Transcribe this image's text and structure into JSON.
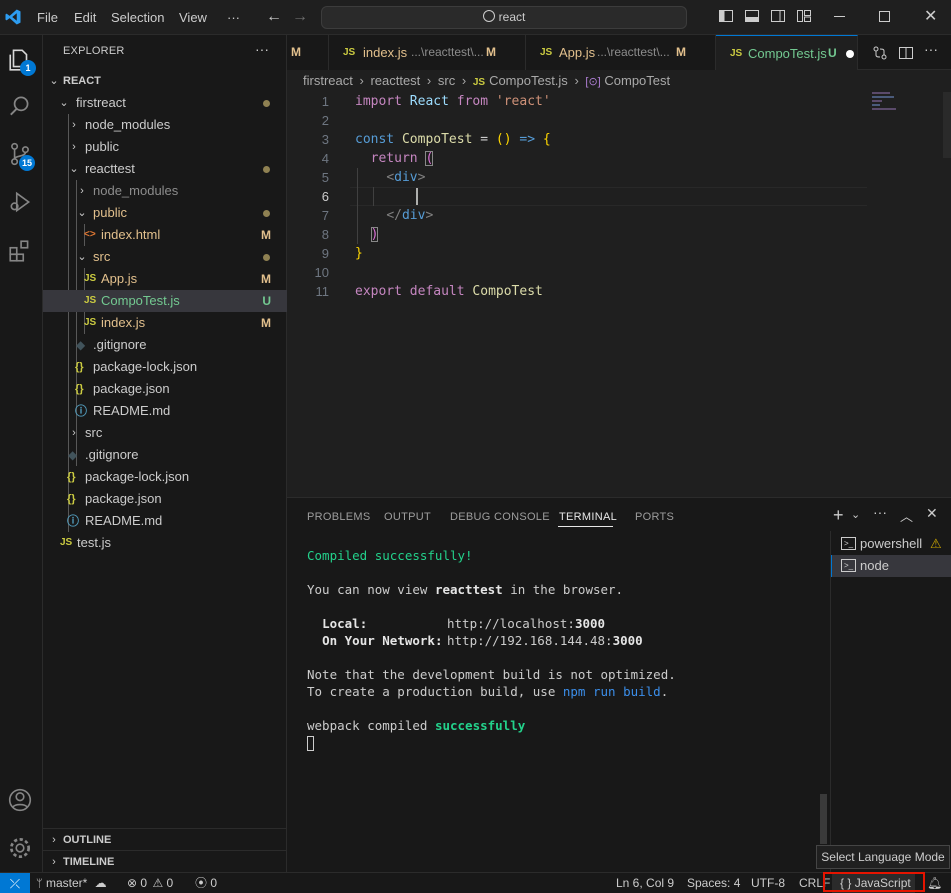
{
  "titlebar": {
    "menus": [
      "File",
      "Edit",
      "Selection",
      "View",
      "···"
    ],
    "search_text": "react",
    "icons": [
      "vscode-logo-icon",
      "back-arrow-icon",
      "forward-arrow-icon",
      "search-icon",
      "toggle-sidebar-icon",
      "toggle-panel-icon",
      "toggle-secondary-sidebar-icon",
      "customize-layout-icon",
      "minimize-icon",
      "maximize-icon",
      "close-icon"
    ]
  },
  "activity": {
    "explorer_badge": "1",
    "scm_badge": "15"
  },
  "explorer": {
    "title": "EXPLORER",
    "more": "···",
    "root": "REACT",
    "items": [
      {
        "label": "firstreact",
        "dec": ""
      },
      {
        "label": "node_modules",
        "dec": ""
      },
      {
        "label": "public",
        "dec": ""
      },
      {
        "label": "reacttest",
        "dec": ""
      },
      {
        "label": "node_modules",
        "dec": ""
      },
      {
        "label": "public",
        "dec": ""
      },
      {
        "label": "index.html",
        "dec": "M",
        "icon": "<>"
      },
      {
        "label": "src",
        "dec": ""
      },
      {
        "label": "App.js",
        "dec": "M",
        "icon": "JS"
      },
      {
        "label": "CompoTest.js",
        "dec": "U",
        "icon": "JS"
      },
      {
        "label": "index.js",
        "dec": "M",
        "icon": "JS"
      },
      {
        "label": ".gitignore",
        "dec": "",
        "icon": "◆"
      },
      {
        "label": "package-lock.json",
        "dec": "",
        "icon": "{}"
      },
      {
        "label": "package.json",
        "dec": "",
        "icon": "{}"
      },
      {
        "label": "README.md",
        "dec": "",
        "icon": "ⓘ"
      },
      {
        "label": "src",
        "dec": ""
      },
      {
        "label": ".gitignore",
        "dec": "",
        "icon": "◆"
      },
      {
        "label": "package-lock.json",
        "dec": "",
        "icon": "{}"
      },
      {
        "label": "package.json",
        "dec": "",
        "icon": "{}"
      },
      {
        "label": "README.md",
        "dec": "",
        "icon": "ⓘ"
      },
      {
        "label": "test.js",
        "dec": "",
        "icon": "JS"
      }
    ],
    "outline": "OUTLINE",
    "timeline": "TIMELINE"
  },
  "tabs": [
    {
      "icon": "",
      "name": "",
      "path": "",
      "dec": "M"
    },
    {
      "icon": "JS",
      "name": "index.js",
      "path": "...\\reacttest\\...",
      "dec": "M"
    },
    {
      "icon": "JS",
      "name": "App.js",
      "path": "...\\reacttest\\...",
      "dec": "M"
    },
    {
      "icon": "JS",
      "name": "CompoTest.js",
      "path": "",
      "dec": "U"
    }
  ],
  "breadcrumb": [
    "firstreact",
    "reacttest",
    "src",
    "CompoTest.js",
    "CompoTest"
  ],
  "code": {
    "line_numbers": [
      "1",
      "2",
      "3",
      "4",
      "5",
      "6",
      "7",
      "8",
      "9",
      "10",
      "11"
    ],
    "current_line": "6"
  },
  "panel": {
    "tabs": [
      "PROBLEMS",
      "OUTPUT",
      "DEBUG CONSOLE",
      "TERMINAL",
      "PORTS"
    ],
    "active_tab": "TERMINAL",
    "terminals": [
      "powershell",
      "node"
    ],
    "output": {
      "compiled": "Compiled successfully!",
      "view_prefix": "You can now view ",
      "app_name": "reacttest",
      "view_suffix": " in the browser.",
      "local_label": "Local:",
      "local_url_pre": "http://localhost:",
      "local_port": "3000",
      "network_label": "On Your Network:",
      "network_url_pre": "http://192.168.144.48:",
      "network_port": "3000",
      "note1": "Note that the development build is not optimized.",
      "note2_pre": "To create a production build, use ",
      "note2_cmd": "npm run build",
      "note2_post": ".",
      "webpack_pre": "webpack compiled ",
      "webpack_status": "successfully"
    }
  },
  "statusbar": {
    "branch": "master*",
    "errors": "0",
    "warnings": "0",
    "ports": "0",
    "position": "Ln 6, Col 9",
    "spaces": "Spaces: 4",
    "encoding": "UTF-8",
    "eol": "CRLF",
    "language_icon": "{ }",
    "language": "JavaScript"
  },
  "tooltip": "Select Language Mode",
  "colors": {
    "accent": "#0078d4",
    "modified": "#e2c08d",
    "untracked": "#73c991",
    "highlight_box": "#e51400"
  }
}
